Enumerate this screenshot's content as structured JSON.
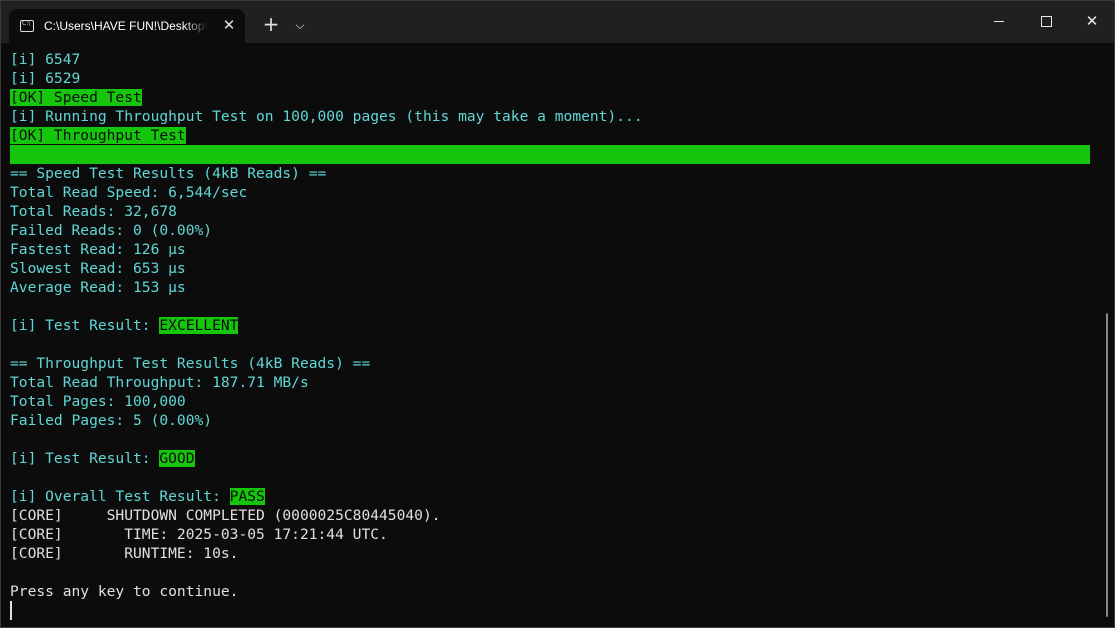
{
  "tab": {
    "title": "C:\\Users\\HAVE FUN!\\Desktop\\",
    "icon": "terminal-icon",
    "close": "✕"
  },
  "titlebar": {
    "new_tab": "+",
    "dropdown": "⌵",
    "close": "✕"
  },
  "colors": {
    "background": "#0c0c0c",
    "text_cyan": "#61d6d6",
    "text_white": "#e0e0e0",
    "highlight_green": "#16c60c"
  },
  "terminal": {
    "l1": "[i] 6547",
    "l2": "[i] 6529",
    "ok_speed": "[OK] Speed Test",
    "running": "[i] Running Throughput Test on 100,000 pages (this may take a moment)...",
    "ok_throughput": "[OK] Throughput Test",
    "progress_value": 1.0,
    "speed_header": "== Speed Test Results (4kB Reads) ==",
    "total_read_speed": "Total Read Speed: 6,544/sec",
    "total_reads": "Total Reads: 32,678",
    "failed_reads": "Failed Reads: 0 (0.00%)",
    "fastest_read": "Fastest Read: 126 µs",
    "slowest_read": "Slowest Read: 653 µs",
    "average_read": "Average Read: 153 µs",
    "test_result_prefix_1": "[i] Test Result: ",
    "test_result_1": "EXCELLENT",
    "throughput_header": "== Throughput Test Results (4kB Reads) ==",
    "total_read_throughput": "Total Read Throughput: 187.71 MB/s",
    "total_pages": "Total Pages: 100,000",
    "failed_pages": "Failed Pages: 5 (0.00%)",
    "test_result_prefix_2": "[i] Test Result: ",
    "test_result_2": "GOOD",
    "overall_prefix": "[i] Overall Test Result: ",
    "overall_result": "PASS",
    "core_shutdown": "[CORE]     SHUTDOWN COMPLETED (0000025C80445040).",
    "core_time": "[CORE]       TIME: 2025-03-05 17:21:44 UTC.",
    "core_runtime": "[CORE]       RUNTIME: 10s.",
    "press_key": "Press any key to continue."
  }
}
